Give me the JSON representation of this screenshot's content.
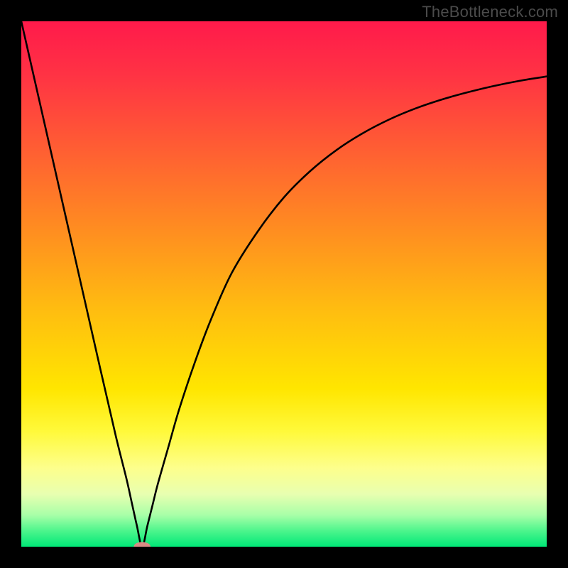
{
  "watermark": "TheBottleneck.com",
  "chart_data": {
    "type": "line",
    "title": "",
    "xlabel": "",
    "ylabel": "",
    "xlim": [
      0,
      100
    ],
    "ylim": [
      0,
      100
    ],
    "x_min": 23,
    "series": [
      {
        "name": "curve",
        "x": [
          0,
          5,
          10,
          15,
          18,
          20,
          21,
          22,
          23,
          24,
          25,
          26,
          28,
          30,
          33,
          36,
          40,
          45,
          50,
          55,
          60,
          65,
          70,
          75,
          80,
          85,
          90,
          95,
          100
        ],
        "values": [
          100,
          78,
          56,
          34,
          21,
          13,
          8.5,
          4,
          0,
          4,
          8,
          12,
          19,
          26,
          35,
          43,
          52,
          60,
          66.5,
          71.5,
          75.5,
          78.7,
          81.3,
          83.4,
          85.1,
          86.5,
          87.7,
          88.7,
          89.5
        ]
      }
    ],
    "marker": {
      "x": 23,
      "y": 0,
      "rx": 1.6,
      "ry": 0.9,
      "color": "#d98b84"
    },
    "background_gradient": {
      "stops": [
        {
          "offset": 0.0,
          "color": "#ff1a4b"
        },
        {
          "offset": 0.1,
          "color": "#ff3244"
        },
        {
          "offset": 0.25,
          "color": "#ff6032"
        },
        {
          "offset": 0.4,
          "color": "#ff8e20"
        },
        {
          "offset": 0.55,
          "color": "#ffbd10"
        },
        {
          "offset": 0.7,
          "color": "#ffe600"
        },
        {
          "offset": 0.78,
          "color": "#fff93a"
        },
        {
          "offset": 0.85,
          "color": "#fdff8c"
        },
        {
          "offset": 0.9,
          "color": "#e8ffb0"
        },
        {
          "offset": 0.94,
          "color": "#a8ffa8"
        },
        {
          "offset": 0.97,
          "color": "#4cf58c"
        },
        {
          "offset": 1.0,
          "color": "#00e877"
        }
      ]
    }
  }
}
